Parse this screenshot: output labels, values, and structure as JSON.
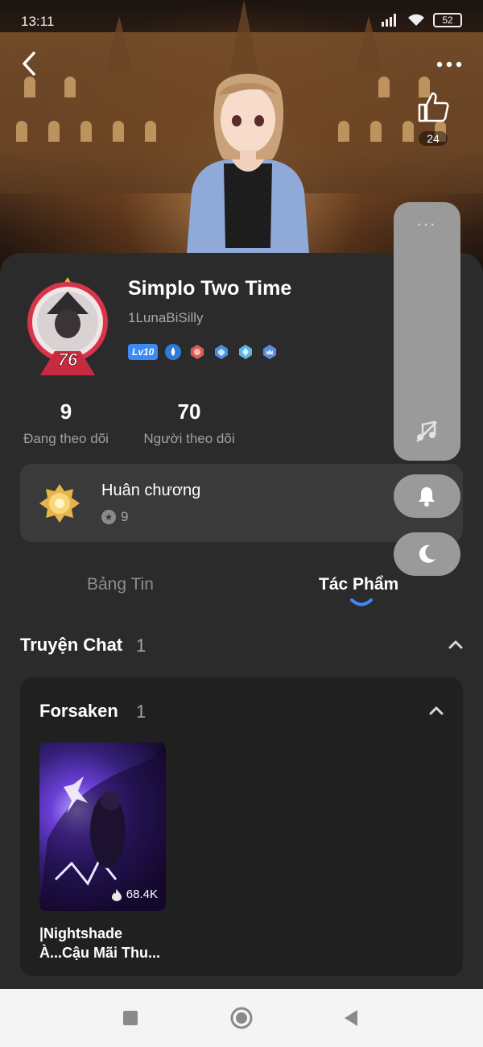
{
  "status_bar": {
    "time": "13:11",
    "battery": "52"
  },
  "header": {
    "like_count": "24"
  },
  "profile": {
    "name": "Simplo Two Time",
    "handle": "1LunaBiSilly",
    "avatar_level": "76",
    "level_badge": "Lv10"
  },
  "stats": {
    "following": {
      "value": "9",
      "label": "Đang theo dõi"
    },
    "followers": {
      "value": "70",
      "label": "Người theo dõi"
    }
  },
  "medals": {
    "title": "Huân chương",
    "count": "9"
  },
  "tabs": [
    {
      "label": "Bảng Tin",
      "active": false
    },
    {
      "label": "Tác Phẩm",
      "active": true
    }
  ],
  "section": {
    "title": "Truyện Chat",
    "count": "1"
  },
  "group": {
    "title": "Forsaken",
    "count": "1",
    "stories": [
      {
        "title": "|Nightshade À...Cậu Mãi Thu...",
        "views": "68.4K"
      }
    ]
  },
  "floating_menu": {
    "dots": "···"
  },
  "colors": {
    "accent": "#3d8af5",
    "tab_indicator": "#3d8af5",
    "card_bg": "#2b2b2b",
    "panel_bg": "#9a9a9a"
  }
}
